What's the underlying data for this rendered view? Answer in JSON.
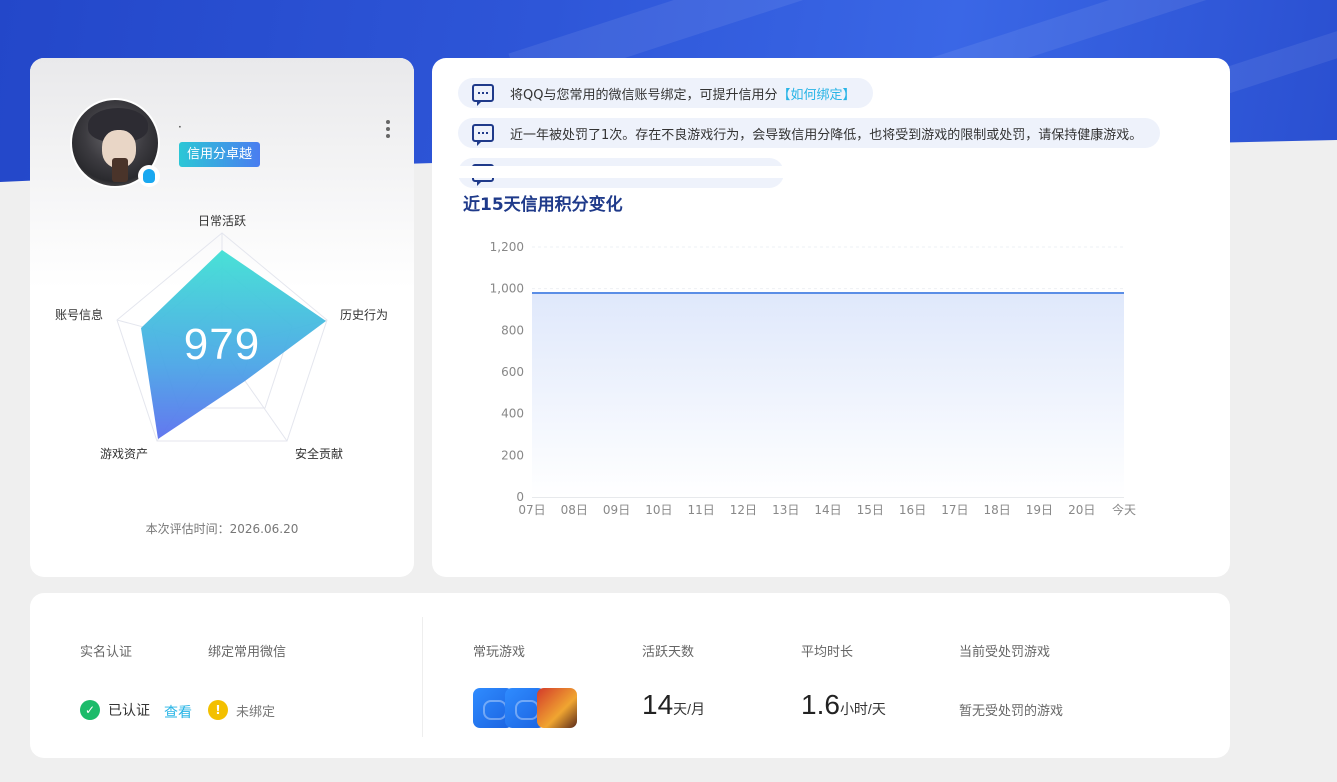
{
  "profile": {
    "nickname": "·",
    "credit_level": "信用分卓越",
    "score": "979",
    "radar_labels": {
      "daily": "日常活跃",
      "history": "历史行为",
      "security": "安全贡献",
      "assets": "游戏资产",
      "account": "账号信息"
    },
    "eval_time": "本次评估时间：2026.06.20"
  },
  "notices": [
    {
      "text": "将QQ与您常用的微信账号绑定，可提升信用分",
      "link": "【如何绑定】"
    },
    {
      "text": "近一年被处罚了1次。存在不良游戏行为，会导致信用分降低，也将受到游戏的限制或处罚，请保持健康游戏。",
      "link": ""
    }
  ],
  "chart": {
    "title": "近15天信用积分变化"
  },
  "chart_data": {
    "type": "area",
    "title": "近15天信用积分变化",
    "xlabel": "",
    "ylabel": "",
    "x": [
      "07日",
      "08日",
      "09日",
      "10日",
      "11日",
      "12日",
      "13日",
      "14日",
      "15日",
      "16日",
      "17日",
      "18日",
      "19日",
      "20日",
      "今天"
    ],
    "yticks": [
      "0",
      "200",
      "400",
      "600",
      "800",
      "1,000",
      "1,200"
    ],
    "ylim": [
      0,
      1200
    ],
    "series": [
      {
        "values": [
          979,
          979,
          979,
          979,
          979,
          979,
          979,
          979,
          979,
          979,
          979,
          979,
          979,
          979,
          979
        ]
      }
    ],
    "grid": true,
    "colors": {
      "line": "#5b8ee6",
      "fill_top": "#dfe8fb"
    }
  },
  "info": {
    "realname_label": "实名认证",
    "wechat_label": "绑定常用微信",
    "realname_status": "已认证",
    "view_link": "查看",
    "wechat_status": "未绑定",
    "games_label": "常玩游戏",
    "active_days_label": "活跃天数",
    "active_days_value": "14",
    "active_days_unit": "天/月",
    "avg_time_label": "平均时长",
    "avg_time_value": "1.6",
    "avg_time_unit": "小时/天",
    "punished_label": "当前受处罚游戏",
    "punished_value": "暂无受处罚的游戏"
  },
  "icons": {
    "ok": "check-circle-icon",
    "warn": "exclamation-circle-icon",
    "notice": "message-icon",
    "more": "more-vertical-icon"
  }
}
